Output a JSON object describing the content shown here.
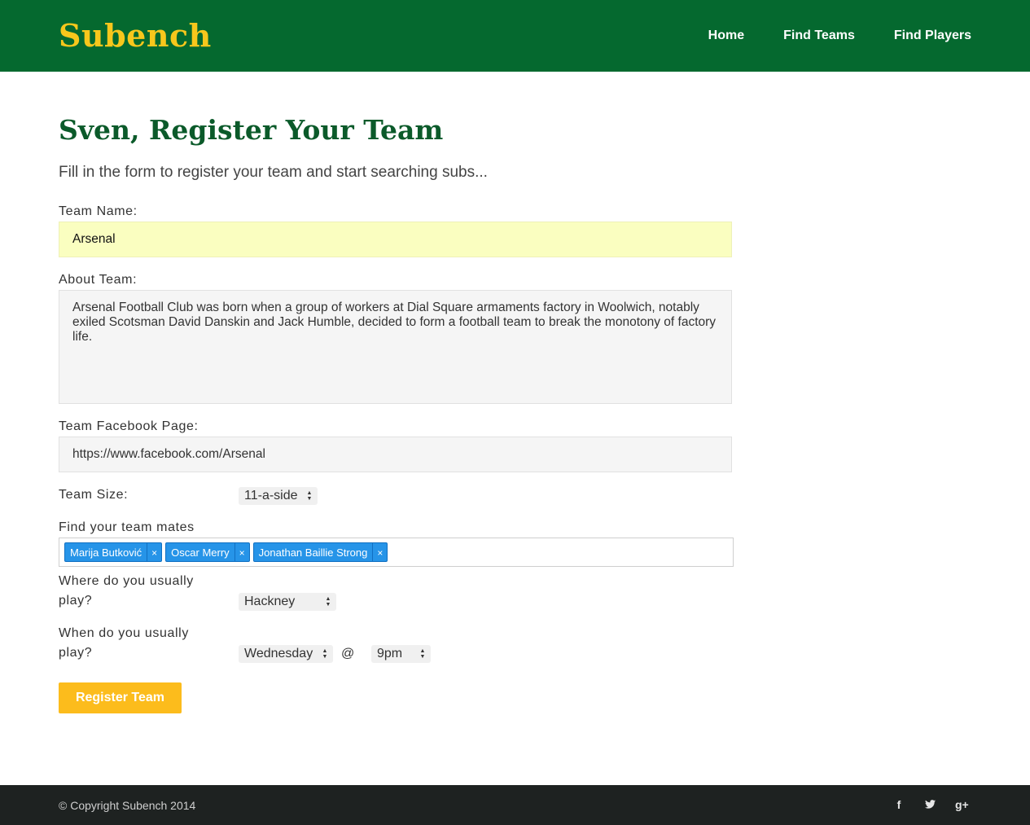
{
  "brand": {
    "name": "Subench",
    "color": "#f7c71c",
    "header_bg": "#05692f"
  },
  "nav": [
    "Home",
    "Find Teams",
    "Find Players"
  ],
  "page": {
    "title": "Sven, Register Your Team",
    "subtitle": "Fill in the form to register your team and start searching subs..."
  },
  "form": {
    "team_name": {
      "label": "Team Name:",
      "value": "Arsenal"
    },
    "about": {
      "label": "About Team:",
      "value": "Arsenal Football Club was born when a group of workers at Dial Square armaments factory in Woolwich, notably exiled Scotsman David Danskin and Jack Humble, decided to form a football team to break the monotony of factory life."
    },
    "facebook": {
      "label": "Team Facebook Page:",
      "value": "https://www.facebook.com/Arsenal"
    },
    "team_size": {
      "label": "Team Size:",
      "value": "11-a-side"
    },
    "team_mates": {
      "label": "Find your team mates",
      "tags": [
        "Marija Butković",
        "Oscar Merry",
        "Jonathan Baillie Strong"
      ],
      "remove_symbol": "×"
    },
    "where": {
      "label": "Where do you usually play?",
      "value": "Hackney"
    },
    "when": {
      "label": "When do you usually play?",
      "day": "Wednesday",
      "at": "@",
      "time": "9pm"
    },
    "submit": "Register Team"
  },
  "footer": {
    "copyright": "© Copyright Subench 2014",
    "social_icons": [
      "facebook-icon",
      "twitter-icon",
      "google-plus-icon"
    ],
    "bg": "#1e2221"
  },
  "accent": {
    "button": "#fcbc1c",
    "tag": "#2694e8",
    "highlight_field": "#fafec0"
  }
}
